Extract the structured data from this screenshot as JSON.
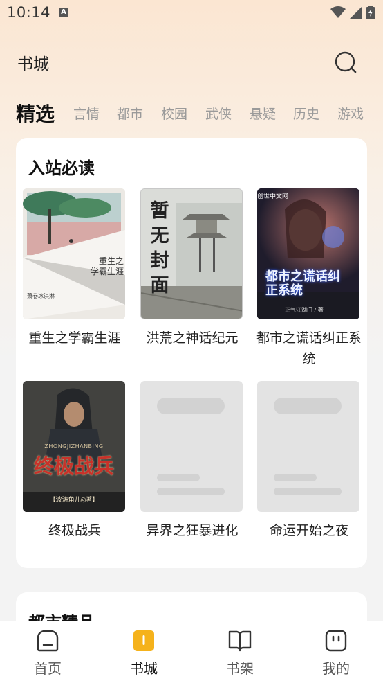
{
  "status": {
    "time": "10:14",
    "badge": "A"
  },
  "header": {
    "title": "书城"
  },
  "tabs": [
    {
      "label": "精选",
      "active": true
    },
    {
      "label": "言情"
    },
    {
      "label": "都市"
    },
    {
      "label": "校园"
    },
    {
      "label": "武侠"
    },
    {
      "label": "悬疑"
    },
    {
      "label": "历史"
    },
    {
      "label": "游戏"
    }
  ],
  "featured": {
    "title": "入站必读",
    "books": [
      {
        "title": "重生之学霸生涯",
        "cover_text": "重生之\n学霸生涯",
        "author": "萧卷冰淇淋"
      },
      {
        "title": "洪荒之神话纪元",
        "cover_text": "暂无封面"
      },
      {
        "title": "都市之谎话纠正系统",
        "cover_text": "都市之谎话纠正系统",
        "author": "正气江湖门 / 著",
        "logo": "创世中文网"
      },
      {
        "title": "终极战兵",
        "cover_text": "终极战兵",
        "subtitle": "ZHONGJIZHANBING",
        "author": "【波涛角儿◎著】"
      },
      {
        "title": "异界之狂暴进化"
      },
      {
        "title": "命运开始之夜"
      }
    ]
  },
  "section2": {
    "title": "都市精品"
  },
  "nav": [
    {
      "label": "首页"
    },
    {
      "label": "书城",
      "active": true
    },
    {
      "label": "书架"
    },
    {
      "label": "我的"
    }
  ],
  "colors": {
    "accent": "#f5b21b",
    "background": "#f3f3f3"
  }
}
